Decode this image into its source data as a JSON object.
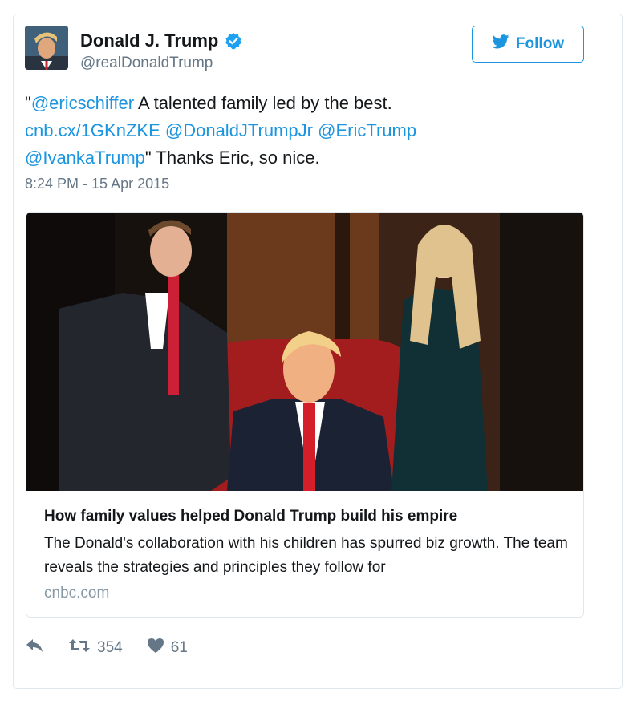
{
  "user": {
    "name": "Donald J. Trump",
    "handle": "@realDonaldTrump",
    "follow_label": "Follow"
  },
  "tweet": {
    "quote_open": "\"",
    "mention1": "@ericschiffer",
    "text1": " A talented family led by the best.",
    "url": "cnb.cx/1GKnZKE",
    "mention2": "@DonaldJTrumpJr",
    "mention3": "@EricTrump",
    "mention4": "@IvankaTrump",
    "text2": "\" Thanks Eric, so nice.",
    "timestamp": "8:24 PM - 15 Apr 2015"
  },
  "card": {
    "title": "How family values helped Donald Trump build his empire",
    "description": "The Donald's collaboration with his children has spurred biz growth. The team reveals the strategies and principles they follow for",
    "domain": "cnbc.com"
  },
  "actions": {
    "retweet_count": "354",
    "like_count": "61"
  },
  "colors": {
    "accent": "#1b95e0",
    "secondary_text": "#657786",
    "border": "#e1e8ed"
  }
}
